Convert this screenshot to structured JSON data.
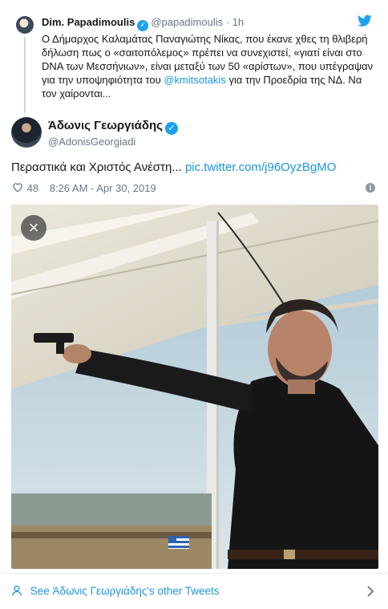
{
  "quoted": {
    "name": "Dim. Papadimoulis",
    "handle": "@papadimoulis",
    "time": "· 1h",
    "text_line1": "Ο Δήμαρχος Καλαμάτας Παναγιώτης Νίκας, που έκανε χθες τη θλιβερή",
    "text_line2": "δήλωση πως ο «σαιτοπόλεμος» πρέπει να συνεχιστεί, «γιατί είναι στο",
    "text_line3": "DNA των Μεσσήνιων», είναι μεταξύ των 50 «αρίστων», που υπέγραψαν",
    "text_line4_pre": "για την υποψηφιότητα του ",
    "text_line4_mention": "@kmitsotakis",
    "text_line4_post": " για την Προεδρία της ΝΔ. Να",
    "text_line5": "τον χαίρονται..."
  },
  "tweet": {
    "name": "Άδωνις Γεωργιάδης",
    "handle": "@AdonisGeorgiadi",
    "text": "Περαστικά και Χριστός Ανέστη... ",
    "link": "pic.twitter.com/j96OyzBgMO",
    "likes": "48",
    "timestamp": "8:26 AM - Apr 30, 2019"
  },
  "footer": {
    "see_more": "See Άδωνις Γεωργιάδης's other Tweets"
  },
  "colors": {
    "link": "#1b95e0",
    "verified": "#1da1f2",
    "muted": "#657786"
  },
  "icons": [
    "twitter-bird-icon",
    "verified-icon",
    "heart-icon",
    "info-icon",
    "close-icon",
    "person-icon",
    "chevron-right-icon"
  ]
}
